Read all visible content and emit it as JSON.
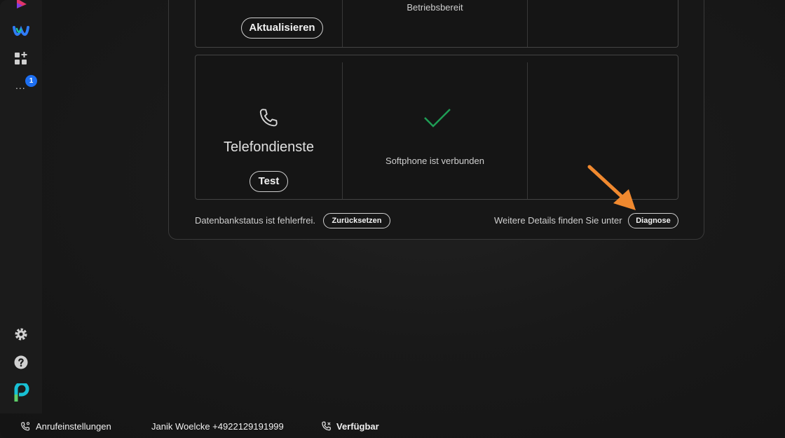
{
  "sidebar": {
    "more_badge": "1",
    "more_label": "..."
  },
  "panel": {
    "top_card": {
      "refresh_button": "Aktualisieren",
      "status": "Betriebsbereit"
    },
    "telephony_card": {
      "title": "Telefondienste",
      "test_button": "Test",
      "status": "Softphone ist verbunden"
    },
    "footer": {
      "db_status": "Datenbankstatus ist fehlerfrei.",
      "reset_button": "Zurücksetzen",
      "details_text": "Weitere Details finden Sie unter",
      "diagnose_button": "Diagnose"
    }
  },
  "bottom_bar": {
    "call_settings": "Anrufeinstellungen",
    "user": "Janik Woelcke +4922129191999",
    "availability": "Verfügbar"
  },
  "colors": {
    "accent_blue": "#1d6ff2",
    "success_green": "#1f9d55",
    "arrow_orange": "#f0892f"
  }
}
